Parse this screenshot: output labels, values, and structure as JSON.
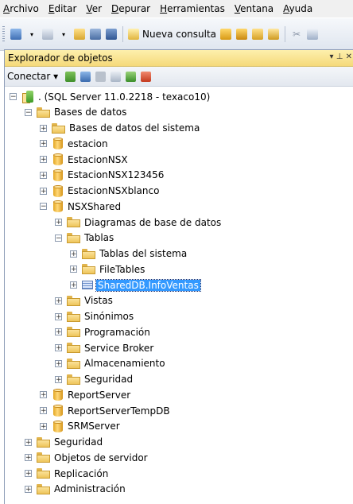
{
  "menu": [
    "Archivo",
    "Editar",
    "Ver",
    "Depurar",
    "Herramientas",
    "Ventana",
    "Ayuda"
  ],
  "toolbar": {
    "new_query_label": "Nueva consulta"
  },
  "panel": {
    "title": "Explorador de objetos",
    "pin": "▾ ⊥ ✕",
    "connect_label": "Conectar ▾"
  },
  "tree": [
    {
      "label": ". (SQL Server 11.0.2218 - texaco10)",
      "icon": "server-icon",
      "expander": "−",
      "level": 0
    },
    {
      "label": "Bases de datos",
      "icon": "folder-icon",
      "expander": "−",
      "level": 1
    },
    {
      "label": "Bases de datos del sistema",
      "icon": "folder-icon",
      "expander": "+",
      "level": 2
    },
    {
      "label": "estacion",
      "icon": "database-icon",
      "expander": "+",
      "level": 2
    },
    {
      "label": "EstacionNSX",
      "icon": "database-icon",
      "expander": "+",
      "level": 2
    },
    {
      "label": "EstacionNSX123456",
      "icon": "database-icon",
      "expander": "+",
      "level": 2
    },
    {
      "label": "EstacionNSXblanco",
      "icon": "database-icon",
      "expander": "+",
      "level": 2
    },
    {
      "label": "NSXShared",
      "icon": "database-icon",
      "expander": "−",
      "level": 2
    },
    {
      "label": "Diagramas de base de datos",
      "icon": "folder-icon",
      "expander": "+",
      "level": 3
    },
    {
      "label": "Tablas",
      "icon": "folder-icon",
      "expander": "−",
      "level": 3
    },
    {
      "label": "Tablas del sistema",
      "icon": "folder-icon",
      "expander": "+",
      "level": 4
    },
    {
      "label": "FileTables",
      "icon": "folder-icon",
      "expander": "+",
      "level": 4
    },
    {
      "label": "SharedDB.InfoVentas",
      "icon": "table-icon",
      "expander": "+",
      "level": 4,
      "selected": true
    },
    {
      "label": "Vistas",
      "icon": "folder-icon",
      "expander": "+",
      "level": 3
    },
    {
      "label": "Sinónimos",
      "icon": "folder-icon",
      "expander": "+",
      "level": 3
    },
    {
      "label": "Programación",
      "icon": "folder-icon",
      "expander": "+",
      "level": 3
    },
    {
      "label": "Service Broker",
      "icon": "folder-icon",
      "expander": "+",
      "level": 3
    },
    {
      "label": "Almacenamiento",
      "icon": "folder-icon",
      "expander": "+",
      "level": 3
    },
    {
      "label": "Seguridad",
      "icon": "folder-icon",
      "expander": "+",
      "level": 3
    },
    {
      "label": "ReportServer",
      "icon": "database-icon",
      "expander": "+",
      "level": 2
    },
    {
      "label": "ReportServerTempDB",
      "icon": "database-icon",
      "expander": "+",
      "level": 2
    },
    {
      "label": "SRMServer",
      "icon": "database-icon",
      "expander": "+",
      "level": 2
    },
    {
      "label": "Seguridad",
      "icon": "folder-icon",
      "expander": "+",
      "level": 1
    },
    {
      "label": "Objetos de servidor",
      "icon": "folder-icon",
      "expander": "+",
      "level": 1
    },
    {
      "label": "Replicación",
      "icon": "folder-icon",
      "expander": "+",
      "level": 1
    },
    {
      "label": "Administración",
      "icon": "folder-icon",
      "expander": "+",
      "level": 1
    }
  ],
  "colors": {
    "selection": "#3399ff",
    "panel_title": "#f5d97a"
  }
}
